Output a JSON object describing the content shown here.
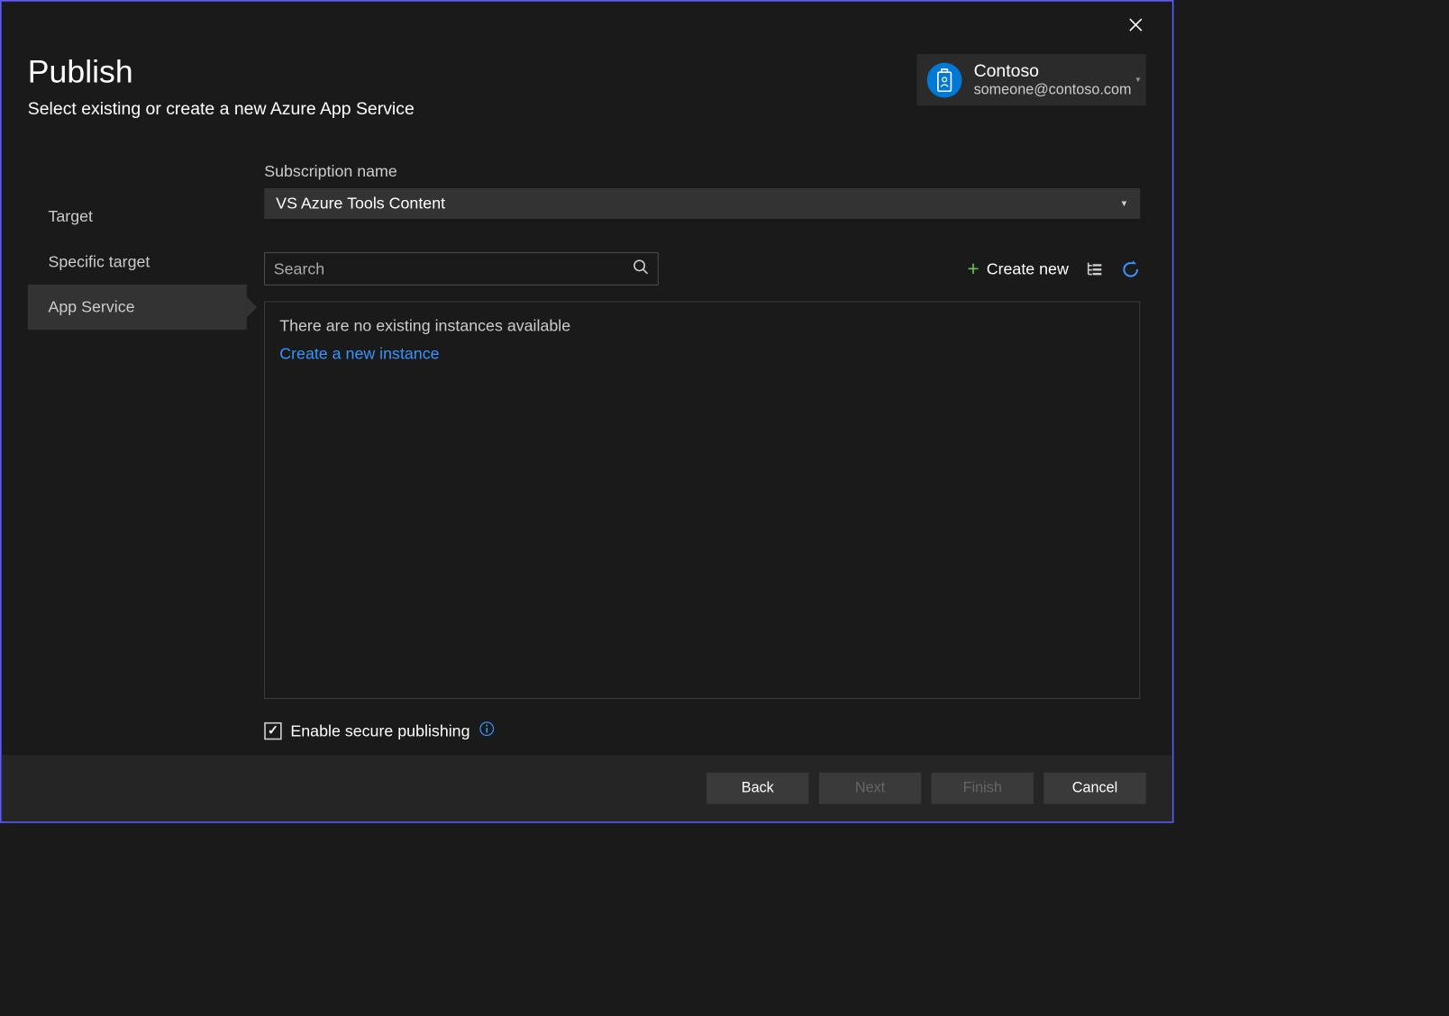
{
  "window": {
    "title": "Publish",
    "subtitle": "Select existing or create a new Azure App Service"
  },
  "account": {
    "name": "Contoso",
    "email": "someone@contoso.com"
  },
  "sidebar": {
    "items": [
      {
        "label": "Target",
        "active": false
      },
      {
        "label": "Specific target",
        "active": false
      },
      {
        "label": "App Service",
        "active": true
      }
    ]
  },
  "subscription": {
    "label": "Subscription name",
    "value": "VS Azure Tools Content"
  },
  "search": {
    "placeholder": "Search"
  },
  "actions": {
    "create_new": "Create new"
  },
  "instances": {
    "empty_message": "There are no existing instances available",
    "create_link": "Create a new instance"
  },
  "secure": {
    "label": "Enable secure publishing",
    "checked": true
  },
  "footer": {
    "back": "Back",
    "next": "Next",
    "finish": "Finish",
    "cancel": "Cancel"
  }
}
